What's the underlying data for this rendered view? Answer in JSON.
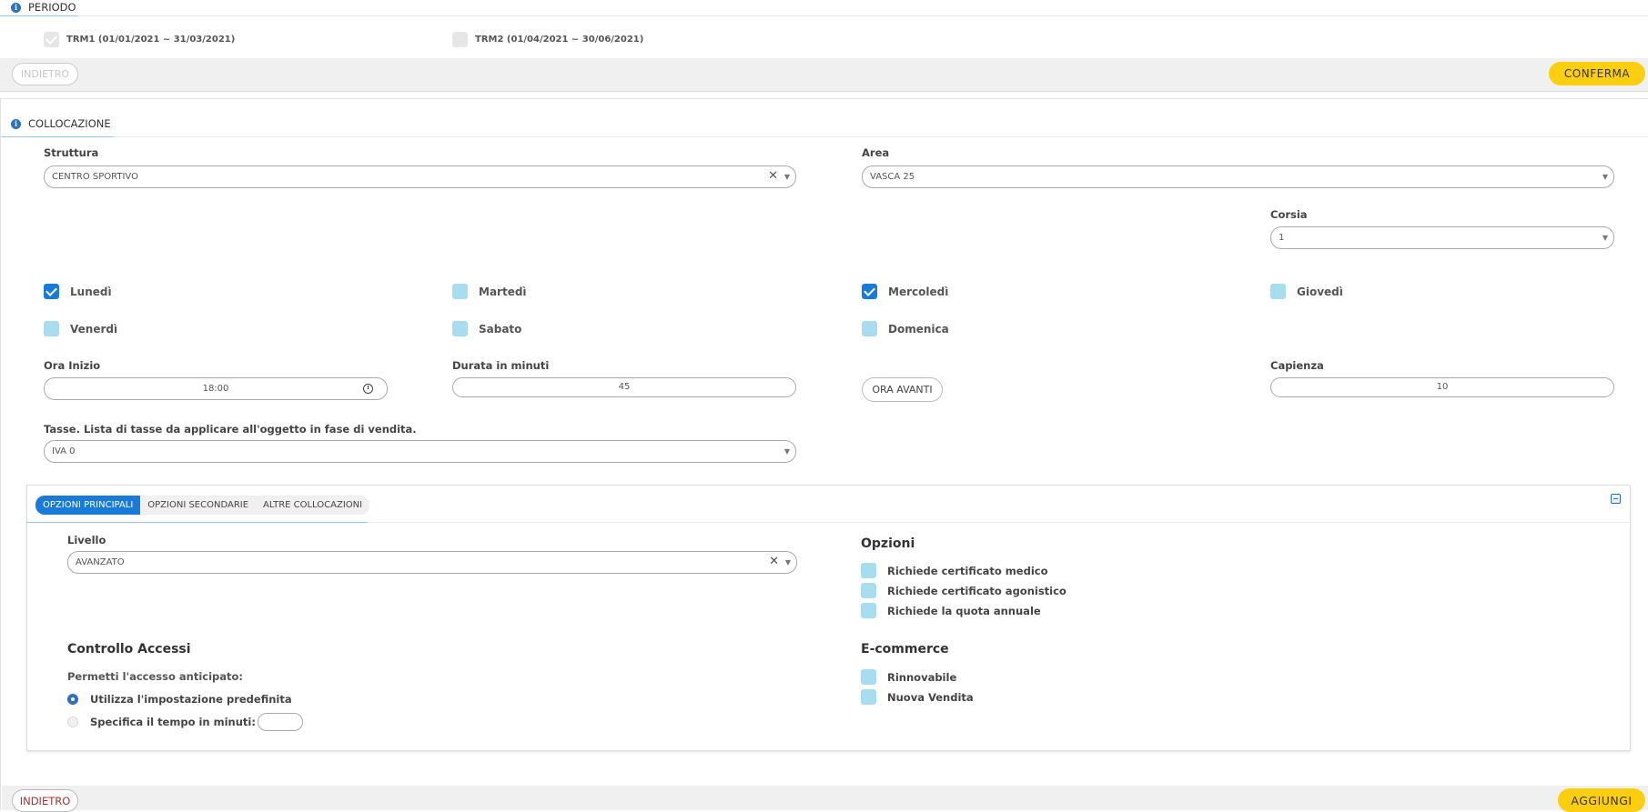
{
  "periodo": {
    "title": "PERIODO",
    "options": [
      {
        "label": "TRM1 (01/01/2021 ~ 31/03/2021)",
        "checked": true
      },
      {
        "label": "TRM2 (01/04/2021 ~ 30/06/2021)",
        "checked": false
      }
    ],
    "back_label": "INDIETRO",
    "confirm_label": "CONFERMA"
  },
  "collocazione": {
    "title": "COLLOCAZIONE",
    "struttura_label": "Struttura",
    "struttura_value": "CENTRO SPORTIVO",
    "area_label": "Area",
    "area_value": "VASCA 25",
    "corsia_label": "Corsia",
    "corsia_value": "1",
    "days": [
      {
        "label": "Lunedì",
        "checked": true
      },
      {
        "label": "Martedì",
        "checked": false
      },
      {
        "label": "Mercoledì",
        "checked": true
      },
      {
        "label": "Giovedì",
        "checked": false
      },
      {
        "label": "Venerdì",
        "checked": false
      },
      {
        "label": "Sabato",
        "checked": false
      },
      {
        "label": "Domenica",
        "checked": false
      }
    ],
    "ora_inizio_label": "Ora Inizio",
    "ora_inizio_value": "18:00",
    "durata_label": "Durata in minuti",
    "durata_value": "45",
    "ora_avanti_label": "ORA AVANTI",
    "capienza_label": "Capienza",
    "capienza_value": "10",
    "tasse_label": "Tasse. Lista di tasse da applicare all'oggetto in fase di vendita.",
    "tasse_value": "IVA 0"
  },
  "tabs": [
    {
      "label": "OPZIONI PRINCIPALI",
      "active": true
    },
    {
      "label": "OPZIONI SECONDARIE",
      "active": false
    },
    {
      "label": "ALTRE COLLOCAZIONI",
      "active": false
    }
  ],
  "opzioni_principali": {
    "livello_label": "Livello",
    "livello_value": "AVANZATO",
    "opzioni_title": "Opzioni",
    "opzioni": [
      {
        "label": "Richiede certificato medico",
        "checked": false
      },
      {
        "label": "Richiede certificato agonistico",
        "checked": false
      },
      {
        "label": "Richiede la quota annuale",
        "checked": false
      }
    ],
    "controllo_title": "Controllo Accessi",
    "accesso_label": "Permetti l'accesso anticipato:",
    "radio_default_label": "Utilizza l'impostazione predefinita",
    "radio_custom_label": "Specifica il tempo in minuti:",
    "ecommerce_title": "E-commerce",
    "ecommerce": [
      {
        "label": "Rinnovabile",
        "checked": false
      },
      {
        "label": "Nuova Vendita",
        "checked": false
      }
    ]
  },
  "footer": {
    "back_label": "INDIETRO",
    "add_label": "AGGIUNGI"
  },
  "colors": {
    "accent": "#1a7ad8",
    "checkbox_unchecked": "#a8dcef",
    "yellow_button": "#fbcf10",
    "back_text": "#b03030"
  }
}
